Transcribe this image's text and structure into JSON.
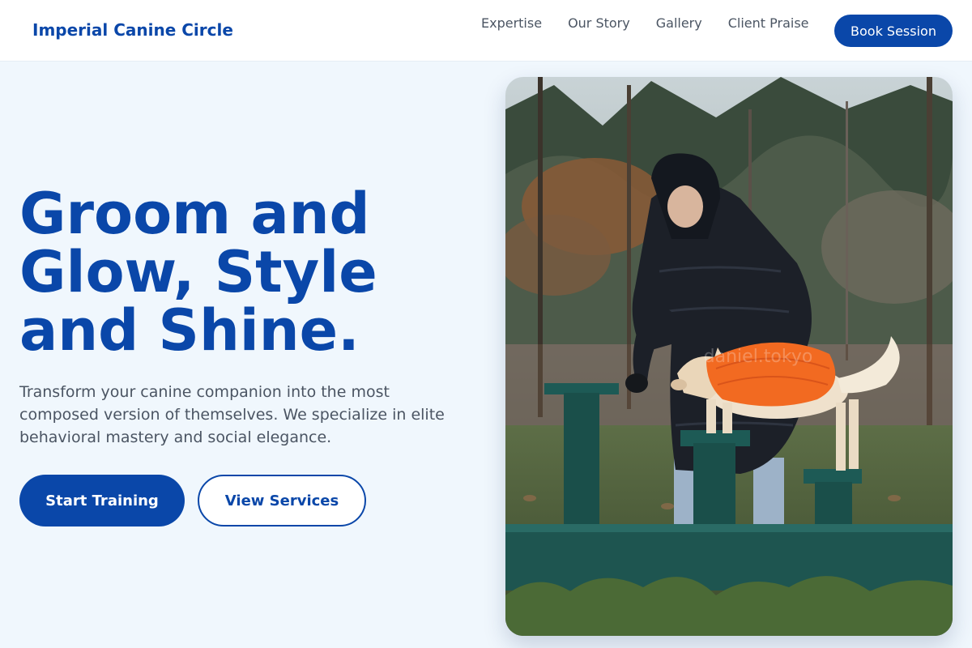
{
  "brand": {
    "name": "Imperial Canine Circle"
  },
  "nav": {
    "links": [
      "Expertise",
      "Our Story",
      "Gallery",
      "Client Praise"
    ],
    "cta": "Book Session"
  },
  "hero": {
    "title": "Groom and Glow, Style and Shine.",
    "subtitle": "Transform your canine companion into the most composed version of themselves. We specialize in elite behavioral mastery and social elegance.",
    "primary_button": "Start Training",
    "secondary_button": "View Services"
  },
  "photo": {
    "watermark": "daniel.tokyo"
  },
  "colors": {
    "accent": "#0a47a9",
    "background": "#f0f7fd",
    "text_muted": "#4b5563"
  }
}
